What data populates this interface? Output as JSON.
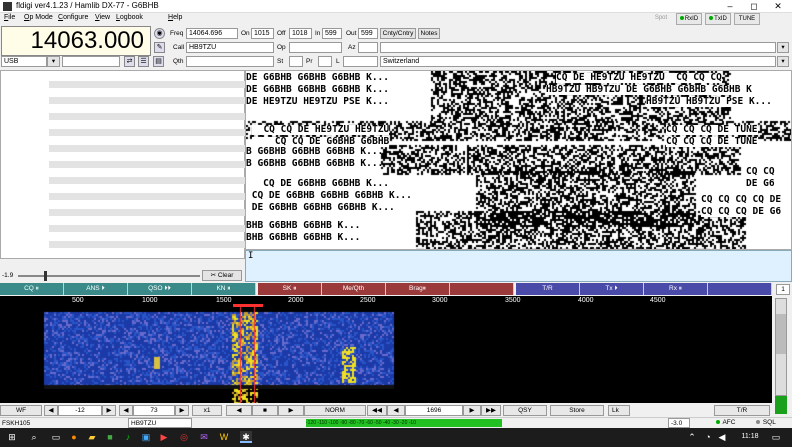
{
  "titlebar": {
    "title": "fldigi ver4.1.23 / Hamlib DX-77 - G6BHB",
    "minimize": "–",
    "maximize": "◻",
    "close": "✕"
  },
  "menu": [
    {
      "label": "File",
      "u": "F",
      "rest": "ile"
    },
    {
      "label": "Op Mode",
      "u": "O",
      "rest": "p Mode"
    },
    {
      "label": "Configure",
      "u": "C",
      "rest": "onfigure"
    },
    {
      "label": "View",
      "u": "V",
      "rest": "iew"
    },
    {
      "label": "Logbook",
      "u": "L",
      "rest": "ogbook"
    },
    {
      "label": "Help",
      "u": "H",
      "rest": "elp"
    }
  ],
  "header_buttons": {
    "spot": "Spot",
    "rxid": "RxID",
    "txid": "TxID",
    "tune": "TUNE"
  },
  "rig": {
    "frequency": "14063.000",
    "mode": "USB"
  },
  "log": {
    "freq_label": "Freq",
    "freq": "14064.696",
    "on_label": "On",
    "on": "1015",
    "off_label": "Off",
    "off": "1018",
    "in_label": "In",
    "in": "599",
    "out_label": "Out",
    "out": "599",
    "cnty_label": "Cnty/Cntry",
    "notes_label": "Notes",
    "call_label": "Call",
    "call": "HB9TZU",
    "op_label": "Op",
    "op": "",
    "az_label": "Az",
    "az": "",
    "qth_label": "Qth",
    "qth": "",
    "st_label": "St",
    "pr_label": "Pr",
    "l_label": "L",
    "country": "Switzerland"
  },
  "rx_text": [
    "DE G6BHB G6BHB G6BHB K...",
    "DE G6BHB G6BHB G6BHB K...",
    "DE HE9TZU HE9TZU PSE K...",
    "  CQ CQ DE HE9TZU HE9TZU",
    "    CQ CQ DE G6BHB G6BHB",
    "B G6BHB G6BHB G6BHB K...",
    "B G6BHB G6BHB G6BHB K...",
    "   CQ DE G6BHB G6BHB K...",
    " CQ DE G6BHB G6BHB G6BHB K...",
    " DE G6BHB G6BHB G6BHB K...",
    "BHB G6BHB G6BHB K...",
    "BHB G6BHB G6BHB K..."
  ],
  "rx_text_right": [
    "CQ DE HE9TZU HE9TZU  CQ CQ CQ",
    "HB9TZU HB9TZU DE G6BHB G6BHB G6BHB K",
    "HB9TZU HB9TZU PSE K...",
    "CQ CQ CQ DE TUNE",
    "CQ CQ CQ DE TUNE",
    "CQ CQ",
    "DE G6",
    "CQ CQ CQ CQ DE",
    "CQ CQ CQ DE G6"
  ],
  "tx_text": "I",
  "signal": {
    "level": "-1.9",
    "clear": "Clear"
  },
  "macros": [
    {
      "label": "CQ ⏸",
      "color": "#3a8a8a"
    },
    {
      "label": "ANS ⏵",
      "color": "#3a8a8a"
    },
    {
      "label": "QSO ⏵⏵",
      "color": "#3a8a8a"
    },
    {
      "label": "KN ⏸",
      "color": "#3a8a8a"
    },
    {
      "label": "SK ⏸",
      "color": "#9a3a3a"
    },
    {
      "label": "Me/Qth",
      "color": "#9a3a3a"
    },
    {
      "label": "Brag⏸",
      "color": "#9a3a3a"
    },
    {
      "label": "",
      "color": "#9a3a3a"
    },
    {
      "label": "T/R",
      "color": "#4a4aa8"
    },
    {
      "label": "Tx ⏵",
      "color": "#4a4aa8"
    },
    {
      "label": "Rx ⏸",
      "color": "#4a4aa8"
    },
    {
      "label": "",
      "color": "#4a4aa8"
    }
  ],
  "macro_set": "1",
  "scale_labels": [
    "500",
    "1000",
    "1500",
    "2000",
    "2500",
    "3000",
    "3500",
    "4000",
    "4500"
  ],
  "controls": {
    "wf": "WF",
    "level": "-12",
    "range": "73",
    "zoom": "x1",
    "norm": "NORM",
    "freq": "1696",
    "qsy": "QSY",
    "store": "Store",
    "lk": "Lk",
    "tr": "T/R",
    "prev": "◀",
    "next": "▶",
    "rew": "◀◀",
    "ff": "▶▶",
    "stop": "■"
  },
  "status": {
    "mode": "FSKH105",
    "call": "HB9TZU",
    "meter": "-120 -110 -100 -90 -80 -70 -60 -50 -40 -30 -20 -10",
    "snr": "-3.0",
    "afc": "AFC",
    "sql": "SQL"
  },
  "taskbar": {
    "time": "11:18"
  },
  "colors": {
    "waterfall_blue": "#1b3aa8",
    "signal_yellow": "#f0e020",
    "marker_red": "#ff3030"
  }
}
